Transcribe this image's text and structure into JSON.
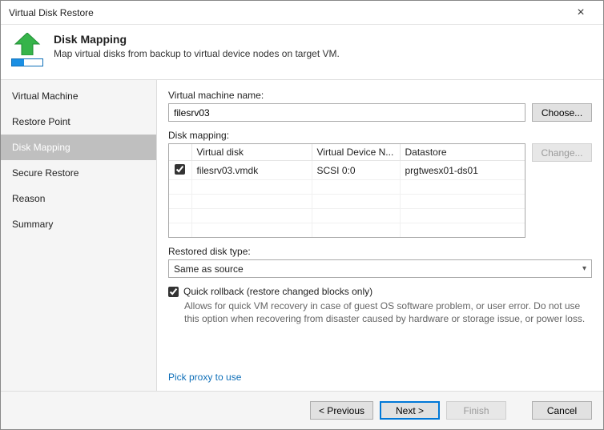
{
  "window": {
    "title": "Virtual Disk Restore"
  },
  "header": {
    "title": "Disk Mapping",
    "subtitle": "Map virtual disks from backup to virtual device nodes on target VM."
  },
  "sidebar": {
    "items": [
      {
        "label": "Virtual Machine",
        "active": false
      },
      {
        "label": "Restore Point",
        "active": false
      },
      {
        "label": "Disk Mapping",
        "active": true
      },
      {
        "label": "Secure Restore",
        "active": false
      },
      {
        "label": "Reason",
        "active": false
      },
      {
        "label": "Summary",
        "active": false
      }
    ]
  },
  "main": {
    "vm_label": "Virtual machine name:",
    "vm_name": "filesrv03",
    "choose_label": "Choose...",
    "mapping_label": "Disk mapping:",
    "change_label": "Change...",
    "columns": {
      "disk": "Virtual disk",
      "node": "Virtual Device N...",
      "datastore": "Datastore"
    },
    "rows": [
      {
        "checked": true,
        "disk": "filesrv03.vmdk",
        "node": "SCSI 0:0",
        "datastore": "prgtwesx01-ds01"
      }
    ],
    "disk_type_label": "Restored disk type:",
    "disk_type_value": "Same as source",
    "quick_rollback_label": "Quick rollback (restore changed blocks only)",
    "quick_rollback_checked": true,
    "quick_rollback_help": "Allows for quick VM recovery in case of guest OS software problem, or user error. Do not use this option when recovering from disaster caused by hardware or storage issue, or power loss.",
    "proxy_link": "Pick proxy to use"
  },
  "footer": {
    "previous": "< Previous",
    "next": "Next >",
    "finish": "Finish",
    "cancel": "Cancel"
  }
}
